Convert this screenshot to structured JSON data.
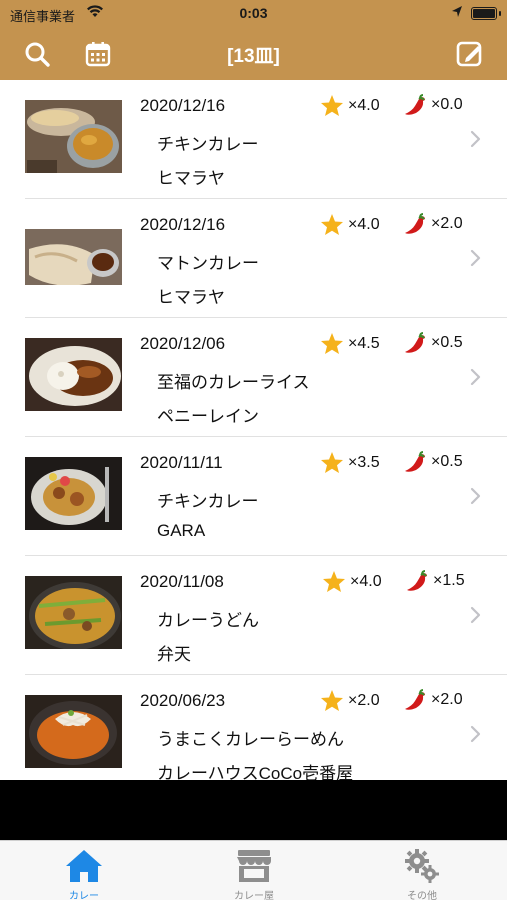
{
  "status_bar": {
    "carrier": "通信事業者",
    "time": "0:03"
  },
  "nav": {
    "title": "[13皿]",
    "left_icons": [
      "search-icon",
      "calendar-icon"
    ],
    "right_icon": "edit-icon"
  },
  "entries": [
    {
      "date": "2020/12/16",
      "stars": "×4.0",
      "spice": "×0.0",
      "dish": "チキンカレー",
      "shop": "ヒマラヤ"
    },
    {
      "date": "2020/12/16",
      "stars": "×4.0",
      "spice": "×2.0",
      "dish": "マトンカレー",
      "shop": "ヒマラヤ"
    },
    {
      "date": "2020/12/06",
      "stars": "×4.5",
      "spice": "×0.5",
      "dish": "至福のカレーライス",
      "shop": "ペニーレイン"
    },
    {
      "date": "2020/11/11",
      "stars": "×3.5",
      "spice": "×0.5",
      "dish": "チキンカレー",
      "shop": "GARA"
    },
    {
      "date": "2020/11/08",
      "stars": "×4.0",
      "spice": "×1.5",
      "dish": "カレーうどん",
      "shop": "弁天"
    },
    {
      "date": "2020/06/23",
      "stars": "×2.0",
      "spice": "×2.0",
      "dish": "うまこくカレーらーめん",
      "shop": "カレーハウスCoCo壱番屋"
    }
  ],
  "tabs": [
    {
      "label": "カレー",
      "icon": "home-icon",
      "active": true
    },
    {
      "label": "カレー屋",
      "icon": "shop-icon",
      "active": false
    },
    {
      "label": "その他",
      "icon": "gears-icon",
      "active": false
    }
  ],
  "colors": {
    "header": "#c4934f",
    "tab_active": "#1e88e5",
    "tab_inactive": "#8e8e8e",
    "star": "#f5b21b",
    "chili": "#d11a1a"
  }
}
